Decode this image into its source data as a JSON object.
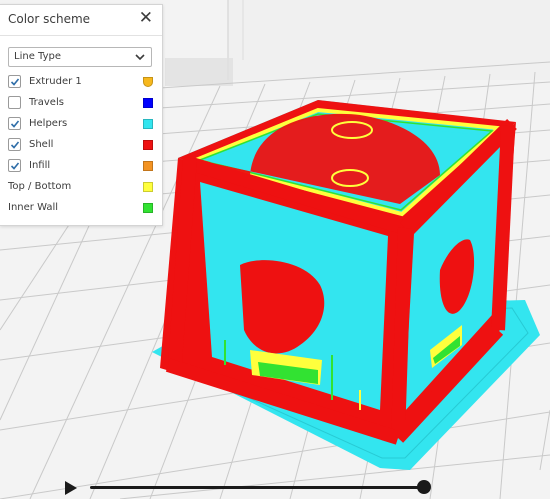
{
  "panel": {
    "title": "Color scheme",
    "close_icon": "close-icon",
    "dropdown": {
      "selected": "Line Type",
      "icon": "chevron-down-icon"
    },
    "line_types": [
      {
        "label": "Extruder 1",
        "checked": true,
        "color": "#f7b81d",
        "swatch_shape": "shield"
      },
      {
        "label": "Travels",
        "checked": false,
        "color": "#0000ff"
      },
      {
        "label": "Helpers",
        "checked": true,
        "color": "#33e5ef"
      },
      {
        "label": "Shell",
        "checked": true,
        "color": "#ee1111"
      },
      {
        "label": "Infill",
        "checked": true,
        "color": "#f39322"
      },
      {
        "label": "Top / Bottom",
        "color": "#ffff3d"
      },
      {
        "label": "Inner Wall",
        "color": "#32e232"
      }
    ]
  },
  "layer_slider": {
    "play_icon": "play-icon",
    "position": 1.0
  },
  "colors": {
    "build_plate": "#f3f3f3",
    "grid_line": "#c9c9c9",
    "shell": "#ee1111",
    "helpers": "#33e5ef",
    "top_bottom": "#ffff3d",
    "inner_wall": "#32e232",
    "accent_ui": "#2f6ea8"
  }
}
